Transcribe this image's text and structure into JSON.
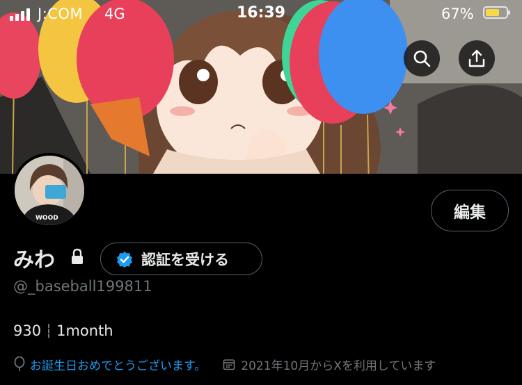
{
  "status_bar": {
    "carrier": "J:COM",
    "network": "4G",
    "time": "16:39",
    "battery_percent_text": "67%",
    "battery_level": 0.67,
    "battery_color": "#f6d84a"
  },
  "header": {
    "search_icon": "search-icon",
    "share_icon": "share-icon"
  },
  "profile": {
    "display_name": "みわ",
    "protected_icon": "lock-icon",
    "handle": "@_baseball199811",
    "edit_label": "編集",
    "verify_label": "認証を受ける",
    "verify_icon": "verified-badge-icon",
    "verify_color": "#1d9bf0"
  },
  "stats": {
    "count": "930",
    "label": "1month"
  },
  "meta": {
    "birthday_icon": "balloon-icon",
    "birthday_text": "お誕生日おめでとうございます。",
    "joined_icon": "calendar-icon",
    "joined_text": "2021年10月からXを利用しています"
  },
  "colors": {
    "background": "#000000",
    "primary_text": "#e7e9ea",
    "secondary_text": "#71767b",
    "accent": "#1d9bf0",
    "border": "#536471"
  }
}
